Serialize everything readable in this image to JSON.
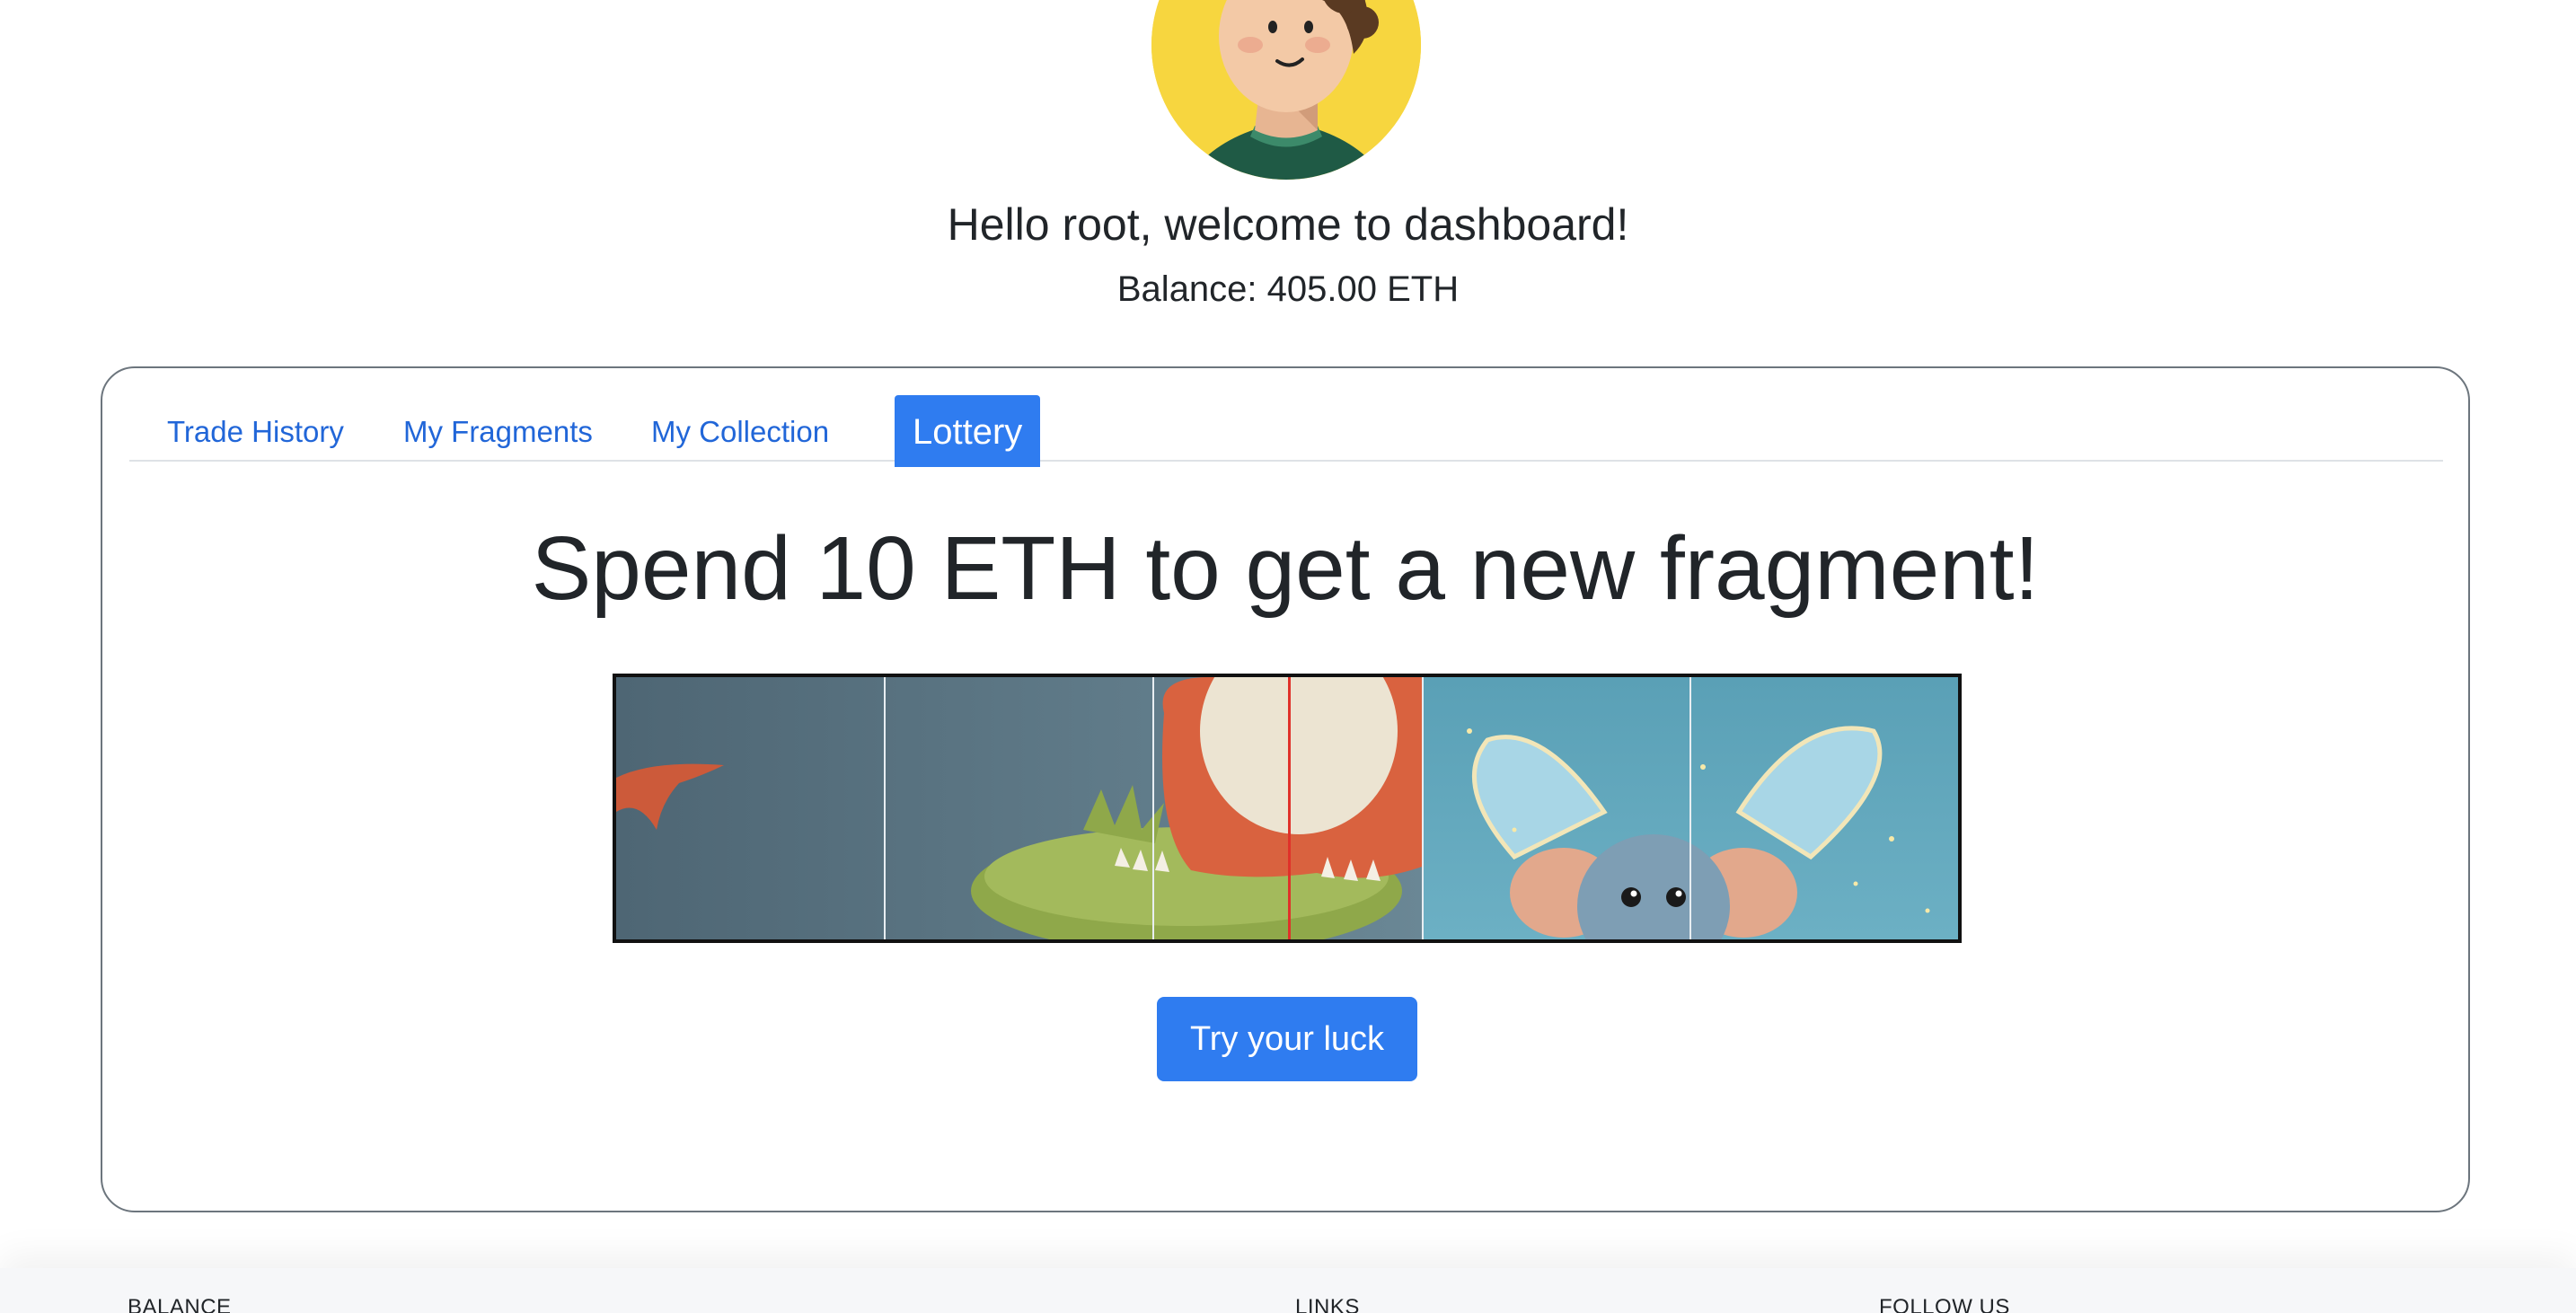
{
  "user": {
    "greeting": "Hello root, welcome to dashboard!",
    "balance": "Balance: 405.00 ETH"
  },
  "tabs": [
    {
      "label": "Trade History",
      "active": false
    },
    {
      "label": "My Fragments",
      "active": false
    },
    {
      "label": "My Collection",
      "active": false
    },
    {
      "label": "Lottery",
      "active": true
    }
  ],
  "lottery": {
    "headline": "Spend 10 ETH to get a new fragment!",
    "button_label": "Try your luck"
  },
  "footer": {
    "balance_heading": "BALANCE",
    "links_heading": "LINKS",
    "follow_heading": "FOLLOW US"
  },
  "colors": {
    "primary": "#2f7cf0",
    "link": "#2166d8",
    "marker": "#e0312a",
    "avatar_bg": "#f7d63f"
  }
}
